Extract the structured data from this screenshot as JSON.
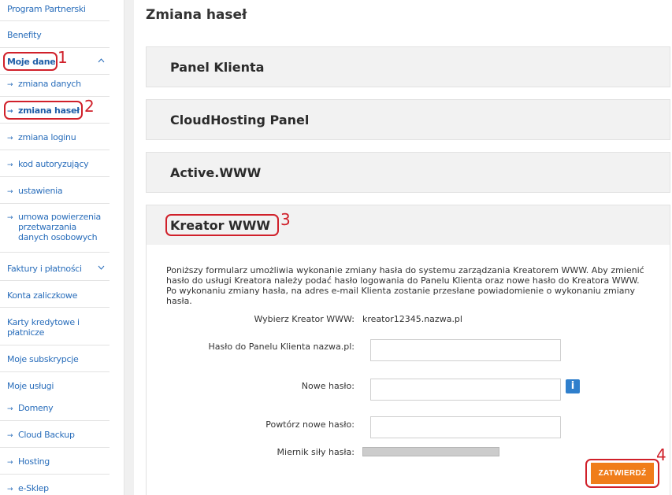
{
  "sidebar": {
    "top_items": [
      "Program Partnerski",
      "Benefity"
    ],
    "moje_dane": "Moje dane",
    "moje_dane_sub": [
      "zmiana danych",
      "zmiana haseł",
      "zmiana loginu",
      "kod autoryzujący",
      "ustawienia",
      "umowa powierzenia przetwarzania danych osobowych"
    ],
    "faktury": "Faktury i płatności",
    "konta": "Konta zaliczkowe",
    "karty": "Karty kredytowe i płatnicze",
    "subskrypcje": "Moje subskrypcje",
    "uslugi": "Moje usługi",
    "uslugi_sub": [
      "Domeny",
      "Cloud Backup",
      "Hosting",
      "e-Sklep"
    ],
    "arrow": "→"
  },
  "annotations": [
    "1",
    "2",
    "3",
    "4"
  ],
  "main": {
    "title": "Zmiana haseł",
    "panels": [
      "Panel Klienta",
      "CloudHosting Panel",
      "Active.WWW",
      "Kreator WWW"
    ],
    "description": "Poniższy formularz umożliwia wykonanie zmiany hasła do systemu zarządzania Kreatorem WWW. Aby zmienić hasło do usługi Kreatora należy podać hasło logowania do Panelu Klienta oraz nowe hasło do Kreatora WWW. Po wykonaniu zmiany hasła, na adres e-mail Klienta zostanie przesłane powiadomienie o wykonaniu zmiany hasła.",
    "form": {
      "select_label": "Wybierz Kreator WWW:",
      "select_value": "kreator12345.nazwa.pl",
      "current_label": "Hasło do Panelu Klienta nazwa.pl:",
      "current_value": "",
      "new_label": "Nowe hasło:",
      "new_value": "",
      "info_icon": "i",
      "repeat_label": "Powtórz nowe hasło:",
      "repeat_value": "",
      "strength_label": "Miernik siły hasła:",
      "strength_level": 0,
      "submit_label": "ZATWIERDŹ"
    }
  },
  "colors": {
    "link": "#2a6ebb",
    "annotation": "#d0202a",
    "submit": "#f07d1a",
    "info": "#2f7fcc"
  }
}
